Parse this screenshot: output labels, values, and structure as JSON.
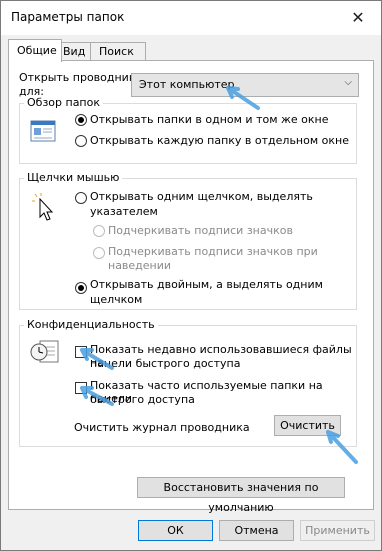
{
  "window": {
    "title": "Параметры папок",
    "close_glyph": "✕"
  },
  "tabs": [
    "Общие",
    "Вид",
    "Поиск"
  ],
  "open_explorer": {
    "label_line1": "Открыть проводник",
    "label_line2": "для:",
    "value": "Этот компьютер"
  },
  "browse": {
    "legend": "Обзор папок",
    "options": [
      "Открывать папки в одном и том же окне",
      "Открывать каждую папку в отдельном окне"
    ],
    "selected": 0
  },
  "clicks": {
    "legend": "Щелчки мышью",
    "single_line1": "Открывать одним щелчком, выделять",
    "single_line2": "указателем",
    "underline_always": "Подчеркивать подписи значков",
    "underline_hover_line1": "Подчеркивать подписи значков при",
    "underline_hover_line2": "наведении",
    "double_line1": "Открывать двойным, а выделять одним",
    "double_line2": "щелчком",
    "selected": "double"
  },
  "privacy": {
    "legend": "Конфиденциальность",
    "recent_files_line1": "Показать недавно использовавшиеся файлы на",
    "recent_files_line2": "панели быстрого доступа",
    "frequent_folders_line1": "Показать часто используемые папки на панели",
    "frequent_folders_line2": "быстрого доступа",
    "recent_files_checked": false,
    "frequent_folders_checked": false,
    "clear_history_label": "Очистить журнал проводника",
    "clear_button": "Очистить"
  },
  "restore_defaults": "Восстановить значения по умолчанию",
  "footer": {
    "ok": "ОК",
    "cancel": "Отмена",
    "apply": "Применить"
  },
  "colors": {
    "accent": "#0078d7",
    "annotation_arrow": "#4a9fe0"
  }
}
